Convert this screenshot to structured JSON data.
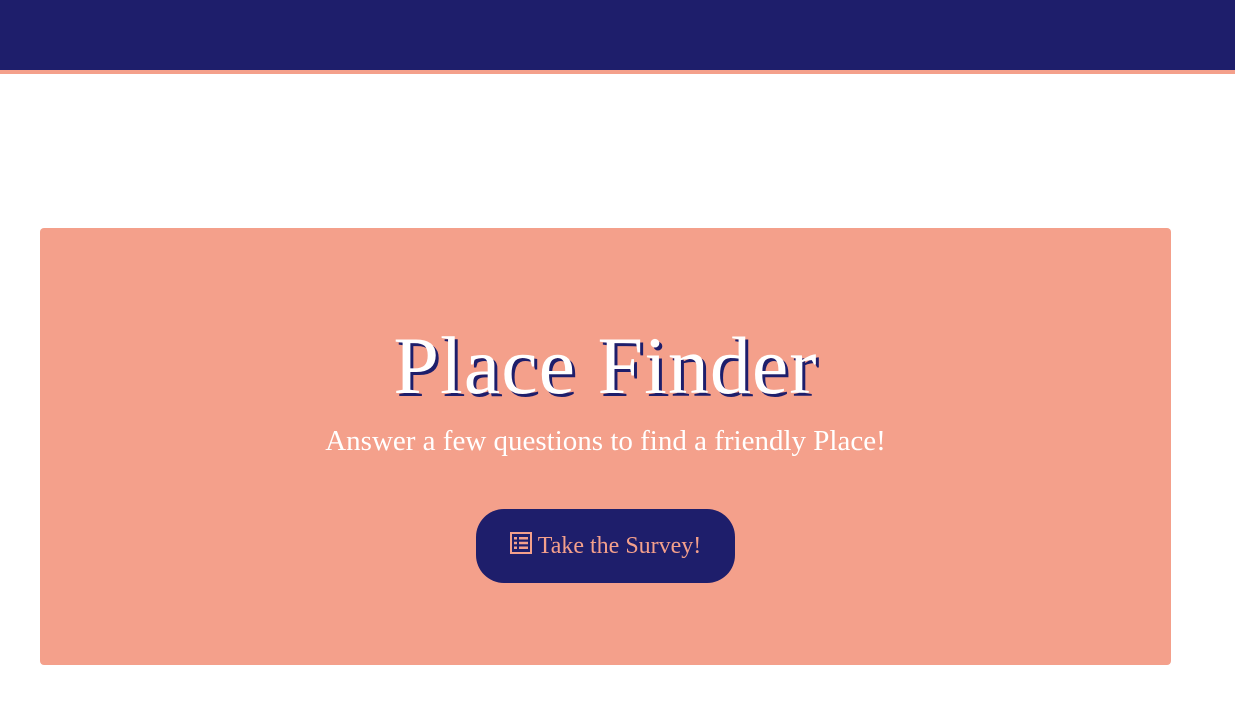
{
  "hero": {
    "title": "Place Finder",
    "subtitle": "Answer a few questions to find a friendly Place!",
    "button_label": "Take the Survey!",
    "button_icon": "list-icon"
  },
  "colors": {
    "navy": "#1e1e6b",
    "salmon": "#f4a08b",
    "white": "#ffffff"
  }
}
